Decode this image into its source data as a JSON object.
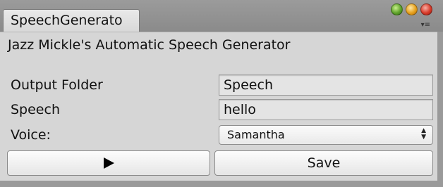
{
  "window": {
    "tab_title": "SpeechGenerato"
  },
  "panel": {
    "header": "Jazz Mickle's Automatic Speech Generator",
    "fields": [
      {
        "label": "Output Folder",
        "value": "Speech"
      },
      {
        "label": "Speech",
        "value": "hello"
      }
    ],
    "voice": {
      "label": "Voice:",
      "selected": "Samantha"
    },
    "buttons": {
      "play_icon": "play-icon",
      "save_label": "Save"
    }
  }
}
